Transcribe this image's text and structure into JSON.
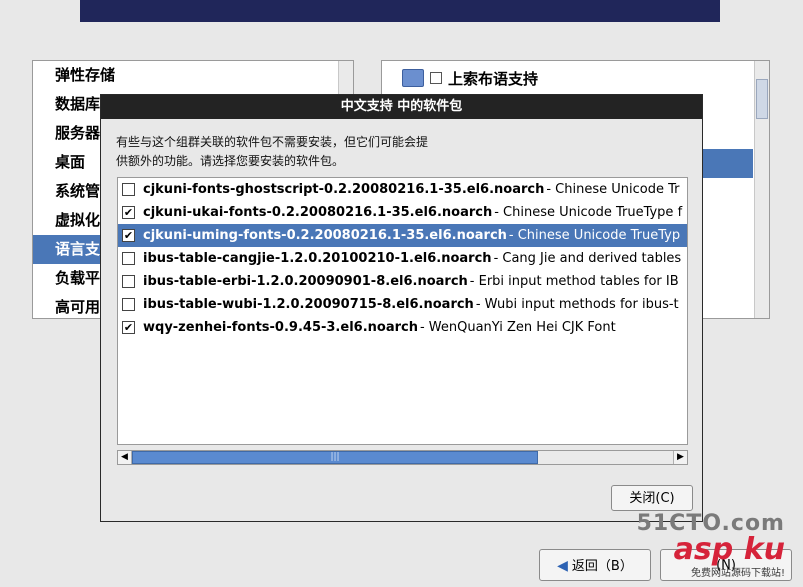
{
  "left_list": {
    "items": [
      {
        "label": "弹性存储",
        "selected": false
      },
      {
        "label": "数据库",
        "selected": false
      },
      {
        "label": "服务器",
        "selected": false
      },
      {
        "label": "桌面",
        "selected": false
      },
      {
        "label": "系统管",
        "selected": false
      },
      {
        "label": "虚拟化",
        "selected": false
      },
      {
        "label": "语言支",
        "selected": true
      },
      {
        "label": "负载平",
        "selected": false
      },
      {
        "label": "高可用",
        "selected": false
      }
    ]
  },
  "right_list": {
    "first_item": {
      "label": "上索布语支持",
      "checked": false,
      "icon": "flag-icon"
    }
  },
  "dialog": {
    "title": "中文支持 中的软件包",
    "description_line1": "有些与这个组群关联的软件包不需要安装，但它们可能会提",
    "description_line2": "供额外的功能。请选择您要安装的软件包。",
    "packages": [
      {
        "name": "cjkuni-fonts-ghostscript-0.2.20080216.1-35.el6.noarch",
        "desc": "- Chinese Unicode Tr",
        "checked": false,
        "selected": false
      },
      {
        "name": "cjkuni-ukai-fonts-0.2.20080216.1-35.el6.noarch",
        "desc": "- Chinese Unicode TrueType f",
        "checked": true,
        "selected": false
      },
      {
        "name": "cjkuni-uming-fonts-0.2.20080216.1-35.el6.noarch",
        "desc": "- Chinese Unicode TrueTyp",
        "checked": true,
        "selected": true
      },
      {
        "name": "ibus-table-cangjie-1.2.0.20100210-1.el6.noarch",
        "desc": "- Cang Jie and derived tables",
        "checked": false,
        "selected": false
      },
      {
        "name": "ibus-table-erbi-1.2.0.20090901-8.el6.noarch",
        "desc": "- Erbi input method tables for IB",
        "checked": false,
        "selected": false
      },
      {
        "name": "ibus-table-wubi-1.2.0.20090715-8.el6.noarch",
        "desc": "- Wubi input methods for ibus-t",
        "checked": false,
        "selected": false
      },
      {
        "name": "wqy-zenhei-fonts-0.9.45-3.el6.noarch",
        "desc": "- WenQuanYi Zen Hei CJK Font",
        "checked": true,
        "selected": false
      }
    ],
    "close_label": "关闭(C)"
  },
  "footer": {
    "back_label": "返回（B）",
    "next_label": "(N)"
  },
  "watermark": {
    "top": "51CTO.com",
    "main": "asp ku",
    "sub": "免费网站源码下载站!"
  },
  "colors": {
    "selection": "#4a77b7",
    "title_bar": "#232323",
    "banner": "#20265a"
  }
}
